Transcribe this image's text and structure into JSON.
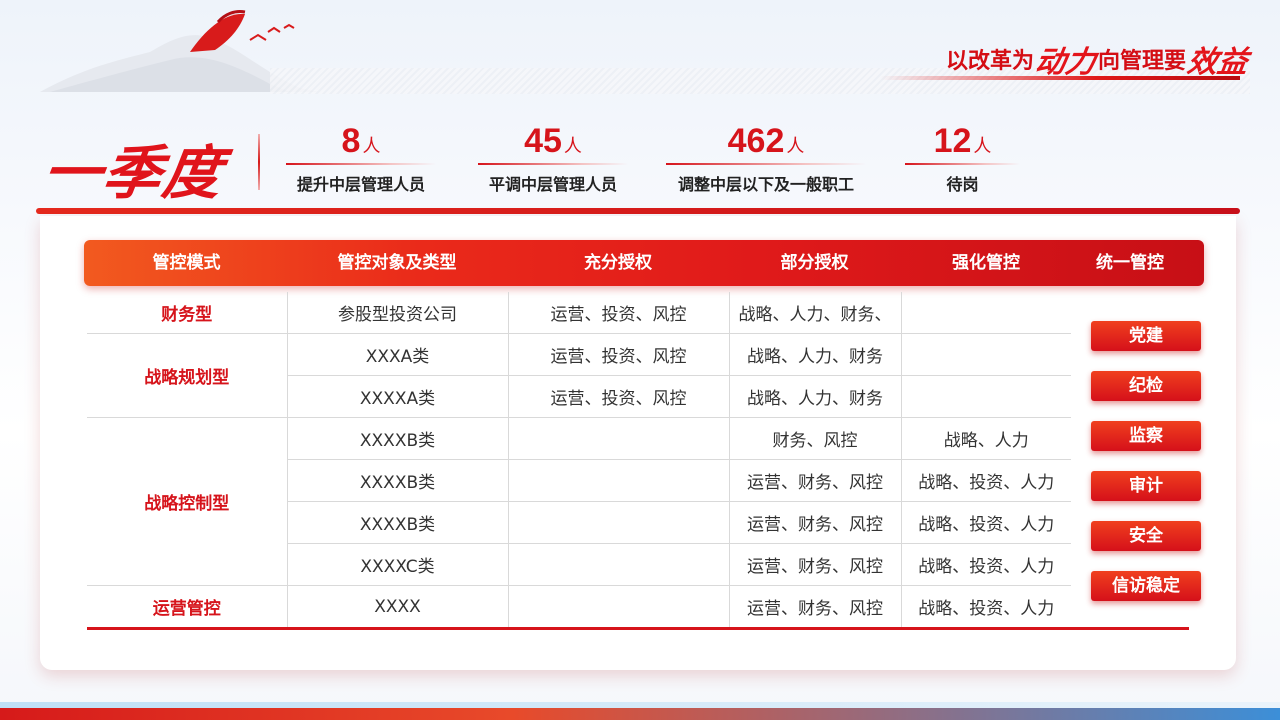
{
  "slogan": {
    "p1": "以改革为",
    "p2": "动力",
    "p3": "向管理要",
    "p4": "效益"
  },
  "title": "一季度",
  "stats": [
    {
      "num": "8",
      "unit": "人",
      "label": "提升中层管理人员"
    },
    {
      "num": "45",
      "unit": "人",
      "label": "平调中层管理人员"
    },
    {
      "num": "462",
      "unit": "人",
      "label": "调整中层以下及一般职工"
    },
    {
      "num": "12",
      "unit": "人",
      "label": "待岗"
    }
  ],
  "headers": [
    "管控模式",
    "管控对象及类型",
    "充分授权",
    "部分授权",
    "强化管控",
    "统一管控"
  ],
  "groups": [
    {
      "name": "财务型",
      "rows": [
        [
          "参股型投资公司",
          "运营、投资、风控",
          "战略、人力、财务、",
          ""
        ]
      ]
    },
    {
      "name": "战略规划型",
      "rows": [
        [
          "XXXA类",
          "运营、投资、风控",
          "战略、人力、财务",
          ""
        ],
        [
          "XXXXA类",
          "运营、投资、风控",
          "战略、人力、财务",
          ""
        ]
      ]
    },
    {
      "name": "战略控制型",
      "rows": [
        [
          "XXXXB类",
          "",
          "财务、风控",
          "战略、人力"
        ],
        [
          "XXXXB类",
          "",
          "运营、财务、风控",
          "战略、投资、人力"
        ],
        [
          "XXXXB类",
          "",
          "运营、财务、风控",
          "战略、投资、人力"
        ],
        [
          "XXXXC类",
          "",
          "运营、财务、风控",
          "战略、投资、人力"
        ]
      ]
    },
    {
      "name": "运营管控",
      "rows": [
        [
          "XXXX",
          "",
          "运营、财务、风控",
          "战略、投资、人力"
        ]
      ]
    }
  ],
  "unified": [
    "党建",
    "纪检",
    "监察",
    "审计",
    "安全",
    "信访稳定"
  ],
  "colors": {
    "accent": "#d6141b",
    "header_start": "#f25a1f",
    "header_end": "#c70f16"
  }
}
